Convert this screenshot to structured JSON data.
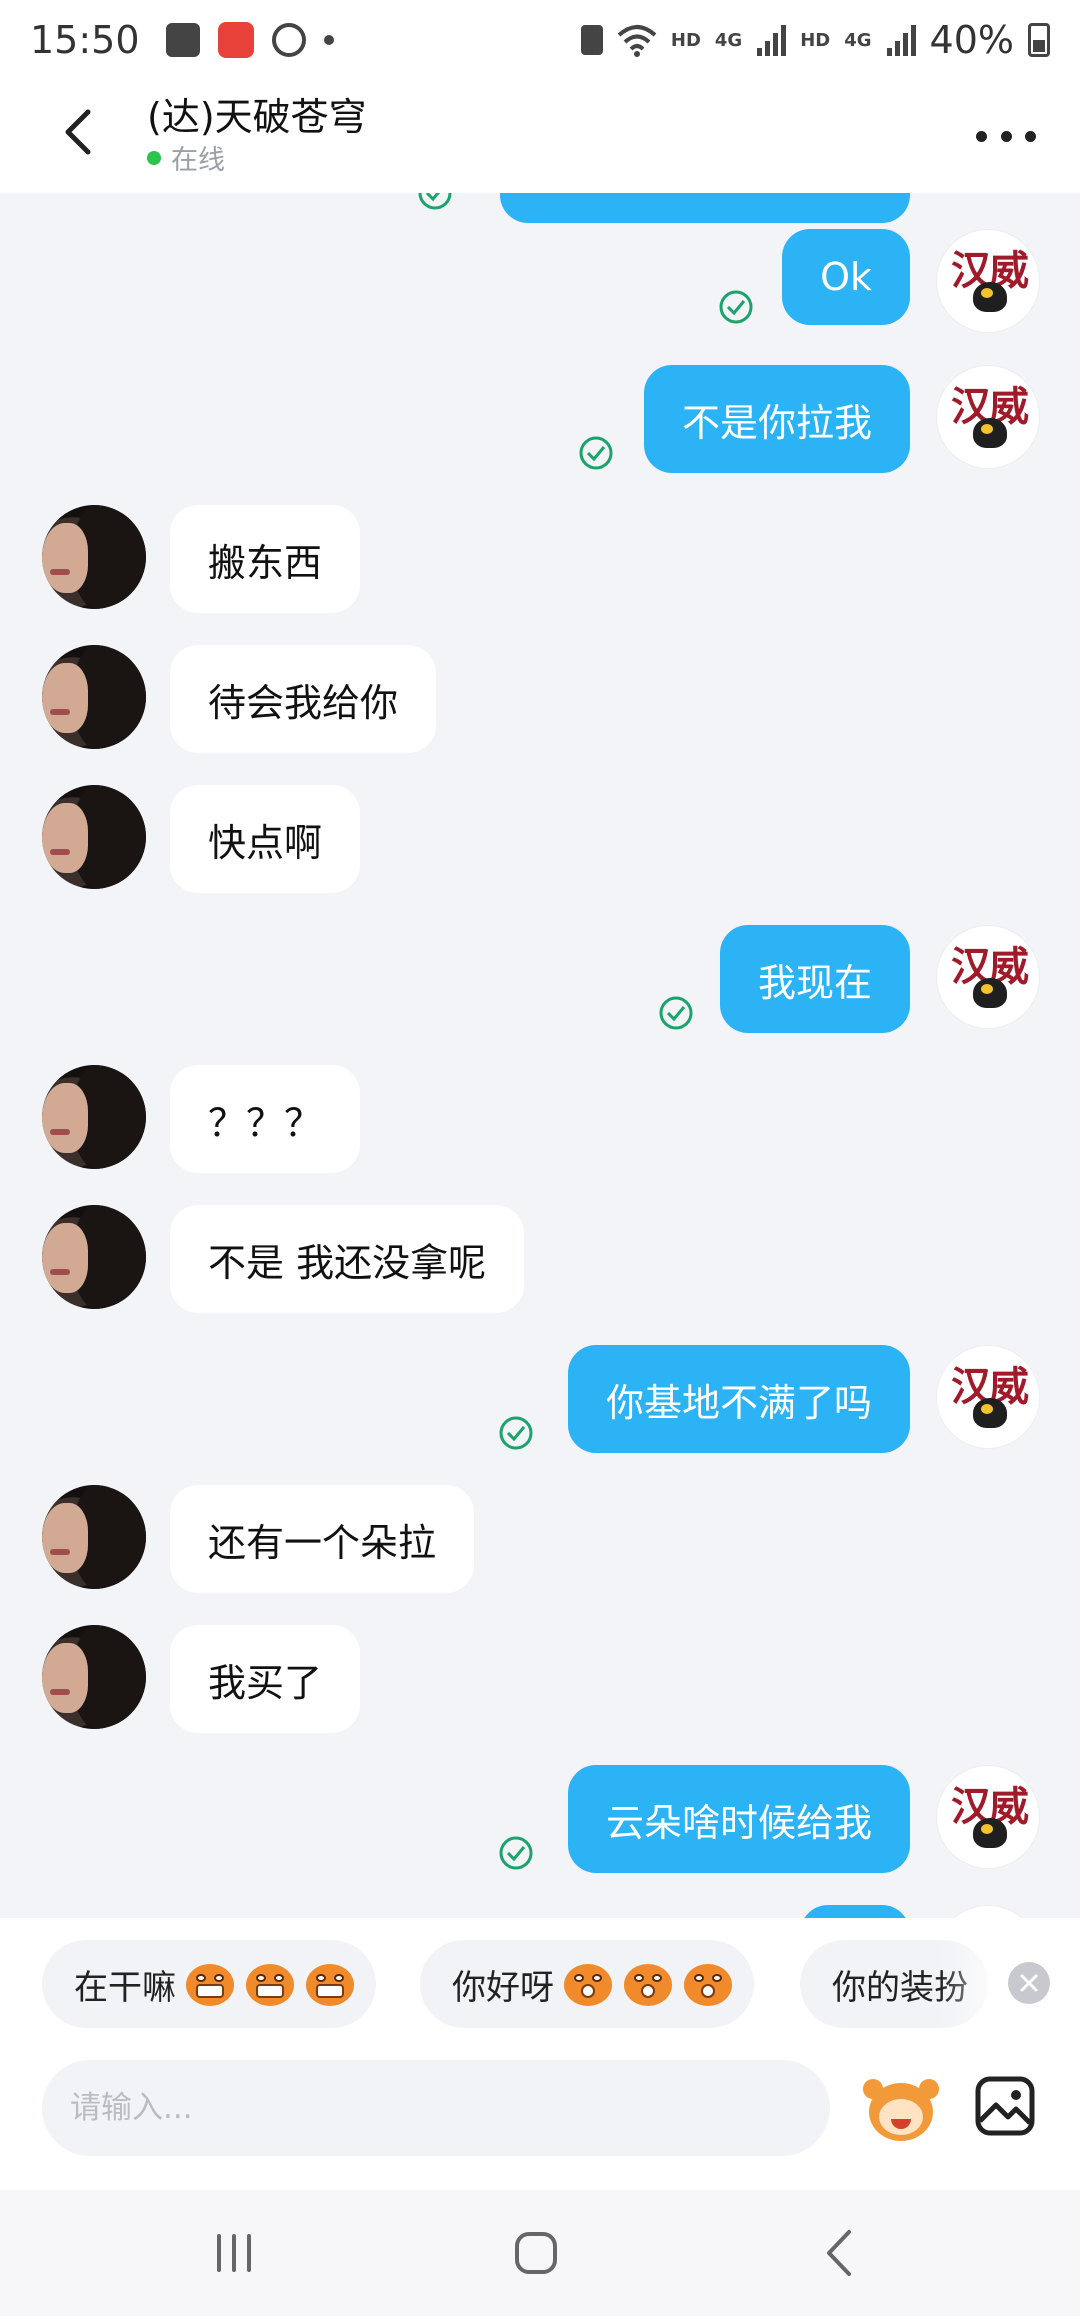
{
  "status_bar": {
    "time": "15:50",
    "network_hd_1": "HD",
    "network_4g_1": "4G",
    "network_hd_2": "HD",
    "network_4g_2": "4G",
    "battery": "40%"
  },
  "header": {
    "title": "(达)天破苍穹",
    "presence": "在线",
    "accent_online": "#2ac44a"
  },
  "avatar_logo_text": "汉威",
  "messages": [
    {
      "side": "out",
      "text": "Ok",
      "read": true
    },
    {
      "side": "out",
      "text": "不是你拉我",
      "read": true
    },
    {
      "side": "in",
      "text": "搬东西"
    },
    {
      "side": "in",
      "text": "待会我给你"
    },
    {
      "side": "in",
      "text": "快点啊"
    },
    {
      "side": "out",
      "text": "我现在",
      "read": true
    },
    {
      "side": "in",
      "text": "？？？"
    },
    {
      "side": "in",
      "text": "不是 我还没拿呢"
    },
    {
      "side": "out",
      "text": "你基地不满了吗",
      "read": true
    },
    {
      "side": "in",
      "text": "还有一个朵拉"
    },
    {
      "side": "in",
      "text": "我买了"
    },
    {
      "side": "out",
      "text": "云朵啥时候给我",
      "read": true
    }
  ],
  "quick_replies": [
    {
      "label": "在干嘛"
    },
    {
      "label": "你好呀"
    },
    {
      "label": "你的装扮"
    }
  ],
  "input": {
    "placeholder": "请输入..."
  },
  "colors": {
    "outgoing_bubble": "#2cb3f5",
    "incoming_bubble": "#ffffff",
    "background": "#f2f4f8",
    "read_check": "#1aa36b"
  },
  "icons": {
    "back": "chevron-left-icon",
    "more": "more-dots-icon",
    "emoji": "emoji-face-icon",
    "image": "image-icon",
    "close": "close-icon"
  }
}
